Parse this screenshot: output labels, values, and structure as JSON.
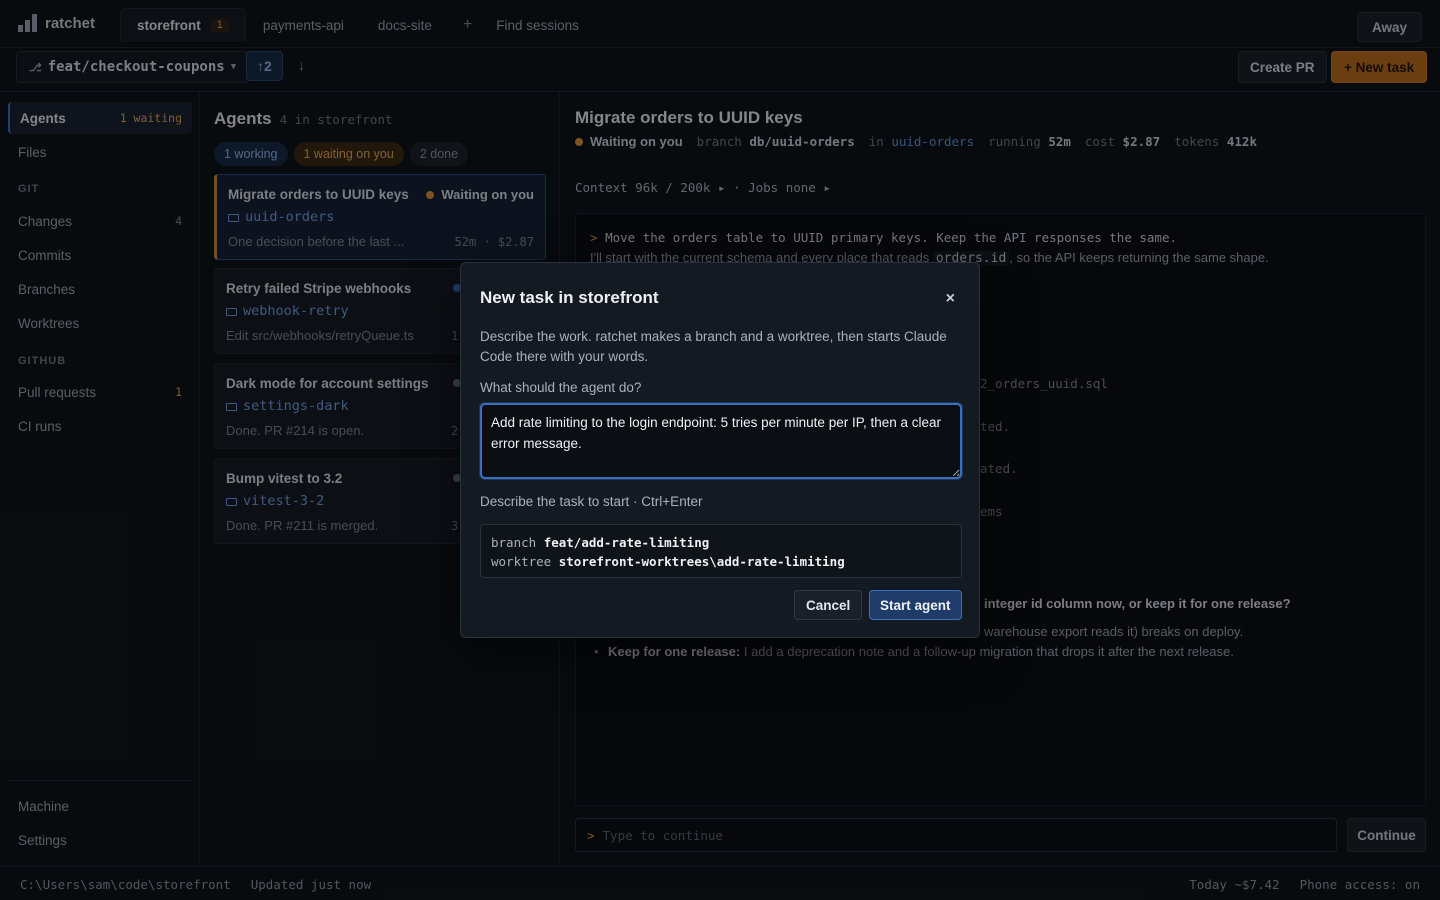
{
  "app": {
    "name": "ratchet"
  },
  "tabs": [
    {
      "label": "storefront",
      "badge": "1"
    },
    {
      "label": "payments-api"
    },
    {
      "label": "docs-site"
    }
  ],
  "tab_add": "+",
  "find_sessions": "Find sessions",
  "away_label": "Away",
  "branch": {
    "name": "feat/checkout-coupons",
    "ahead": "2"
  },
  "create_pr": "Create PR",
  "new_task": "+ New task",
  "sidebar": {
    "agents": {
      "label": "Agents",
      "count": "1 waiting"
    },
    "files": "Files",
    "git_heading": "GIT",
    "changes": {
      "label": "Changes",
      "count": "4"
    },
    "commits": "Commits",
    "branches": "Branches",
    "worktrees": "Worktrees",
    "github_heading": "GITHUB",
    "pull_requests": {
      "label": "Pull requests",
      "count": "1"
    },
    "ci_runs": "CI runs",
    "machine": "Machine",
    "settings": "Settings"
  },
  "agents_panel": {
    "title": "Agents",
    "subtitle": "4 in storefront",
    "filters": {
      "working": "1 working",
      "waiting": "1 waiting on you",
      "done": "2 done"
    },
    "cards": [
      {
        "title": "Migrate orders to UUID keys",
        "status": "Waiting on you",
        "worktree": "uuid-orders",
        "desc": "One decision before the last ...",
        "meta": "52m · $2.87"
      },
      {
        "title": "Retry failed Stripe webhooks",
        "worktree": "webhook-retry",
        "desc": "Edit src/webhooks/retryQueue.ts",
        "meta": "1"
      },
      {
        "title": "Dark mode for account settings",
        "worktree": "settings-dark",
        "desc": "Done. PR #214 is open.",
        "meta": "2"
      },
      {
        "title": "Bump vitest to 3.2",
        "worktree": "vitest-3-2",
        "desc": "Done. PR #211 is merged.",
        "meta": "3"
      }
    ]
  },
  "task": {
    "title": "Migrate orders to UUID keys",
    "status": "Waiting on you",
    "branch_label": "branch",
    "branch": "db/uuid-orders",
    "in_label": "in",
    "worktree": "uuid-orders",
    "running_label": "running",
    "running": "52m",
    "cost_label": "cost",
    "cost": "$2.87",
    "tokens_label": "tokens",
    "tokens": "412k",
    "context": "Context 96k / 200k ▸ · Jobs none ▸"
  },
  "transcript": {
    "prompt_marker": ">",
    "prompt": "Move the orders table to UUID primary keys. Keep the API responses the same.",
    "reply_before": "I'll start with the current schema and every place that reads",
    "reply_code": "orders.id",
    "reply_after": ", so the API keeps returning the same shape.",
    "frag1": "2_orders_uuid.sql",
    "frag2": "ted.",
    "frag3": "ated.",
    "frag4": "ems",
    "question": "integer id column now, or keep it for one release?",
    "bullet1_tail": "warehouse export reads it) breaks on deploy.",
    "bullet2_label": "Keep for one release:",
    "bullet2_text": "I add a deprecation note and a follow-up migration that drops it after the next release."
  },
  "continue": {
    "marker": ">",
    "placeholder": "Type to continue",
    "button": "Continue"
  },
  "statusbar": {
    "path": "C:\\Users\\sam\\code\\storefront",
    "updated": "Updated just now",
    "today": "Today ~$7.42",
    "phone": "Phone access: on"
  },
  "modal": {
    "title": "New task in storefront",
    "close": "×",
    "description": "Describe the work. ratchet makes a branch and a worktree, then starts Claude Code there with your words.",
    "prompt_label": "What should the agent do?",
    "prompt_value": "Add rate limiting to the login endpoint: 5 tries per minute per IP, then a clear error message.",
    "hint": "Describe the task to start · Ctrl+Enter",
    "branch_label": "branch",
    "branch_value": "feat/add-rate-limiting",
    "worktree_label": "worktree",
    "worktree_value": "storefront-worktrees\\add-rate-limiting",
    "cancel": "Cancel",
    "start": "Start agent"
  },
  "colors": {
    "accent_blue": "#3d6fbf",
    "accent_amber": "#d9903e",
    "new_task_orange": "#b96c1f",
    "background": "#0f1419"
  },
  "icons": [
    "ratchet-logo-icon",
    "git-branch-icon",
    "chevron-down-icon",
    "arrow-up-icon",
    "arrow-down-icon",
    "folder-icon",
    "status-dot-icon",
    "close-icon",
    "resize-grip-icon"
  ]
}
